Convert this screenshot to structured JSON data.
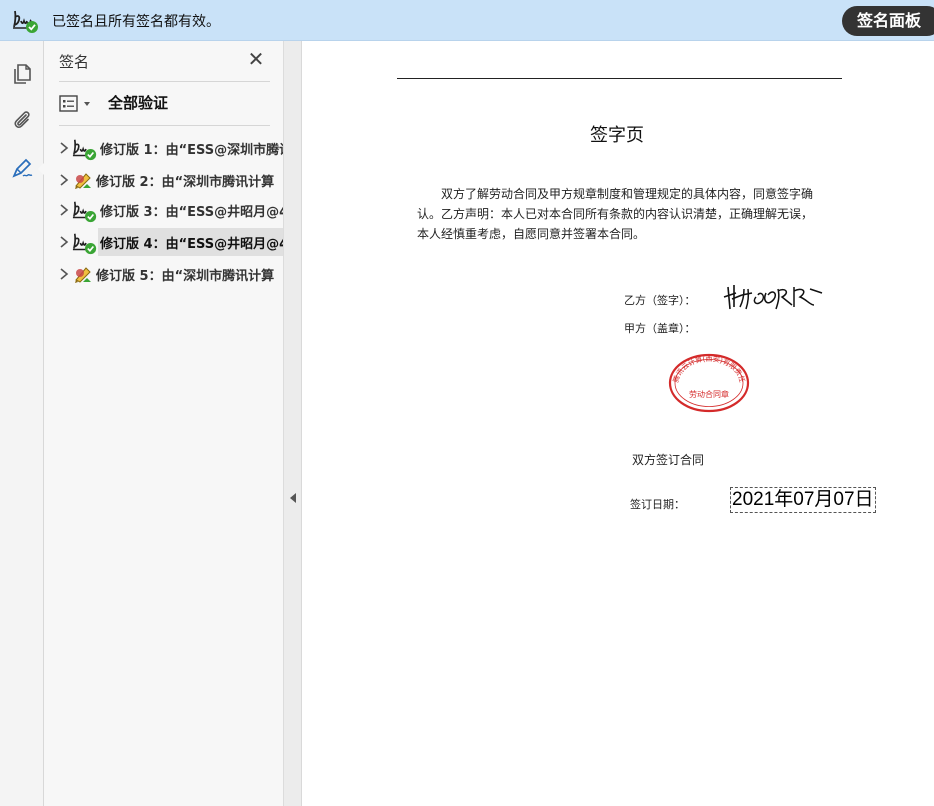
{
  "infobar": {
    "message": "已签名且所有签名都有效。",
    "panel_button": "签名面板",
    "icon": "signature-valid-icon"
  },
  "rail": {
    "tools": [
      "pages-icon",
      "attachment-icon",
      "signature-pen-icon"
    ]
  },
  "signature_panel": {
    "title": "签名",
    "options_icon": "options-list-icon",
    "verify_all": "全部验证",
    "revisions": [
      {
        "label": "修订版 1：由“ESS@深圳市腾讯",
        "status": "valid"
      },
      {
        "label": "修订版 2：由“深圳市腾讯计算",
        "status": "warning"
      },
      {
        "label": "修订版 3：由“ESS@井昭月@4",
        "status": "valid"
      },
      {
        "label": "修订版 4：由“ESS@井昭月@4",
        "status": "valid",
        "selected": true
      },
      {
        "label": "修订版 5：由“深圳市腾讯计算",
        "status": "warning"
      }
    ]
  },
  "document": {
    "heading": "签字页",
    "paragraph": "双方了解劳动合同及甲方规章制度和管理规定的具体内容，同意签字确认。乙方声明：本人已对本合同所有条款的内容认识清楚，正确理解无误，本人经慎重考虑，自愿同意并签署本合同。",
    "party_b_label": "乙方（签字）：",
    "party_a_label": "甲方（盖章）：",
    "seal_outer_text": "腾讯云计算(西安)有限责任公司",
    "seal_inner_text": "劳动合同章",
    "signed_text": "双方签订合同",
    "date_label": "签订日期：",
    "date_value": "2021年07月07日"
  },
  "colors": {
    "infobar_bg": "#c9e2f8",
    "valid_green": "#3aa535",
    "seal_red": "#d42a2a",
    "rail_accent": "#2a6ebb"
  }
}
